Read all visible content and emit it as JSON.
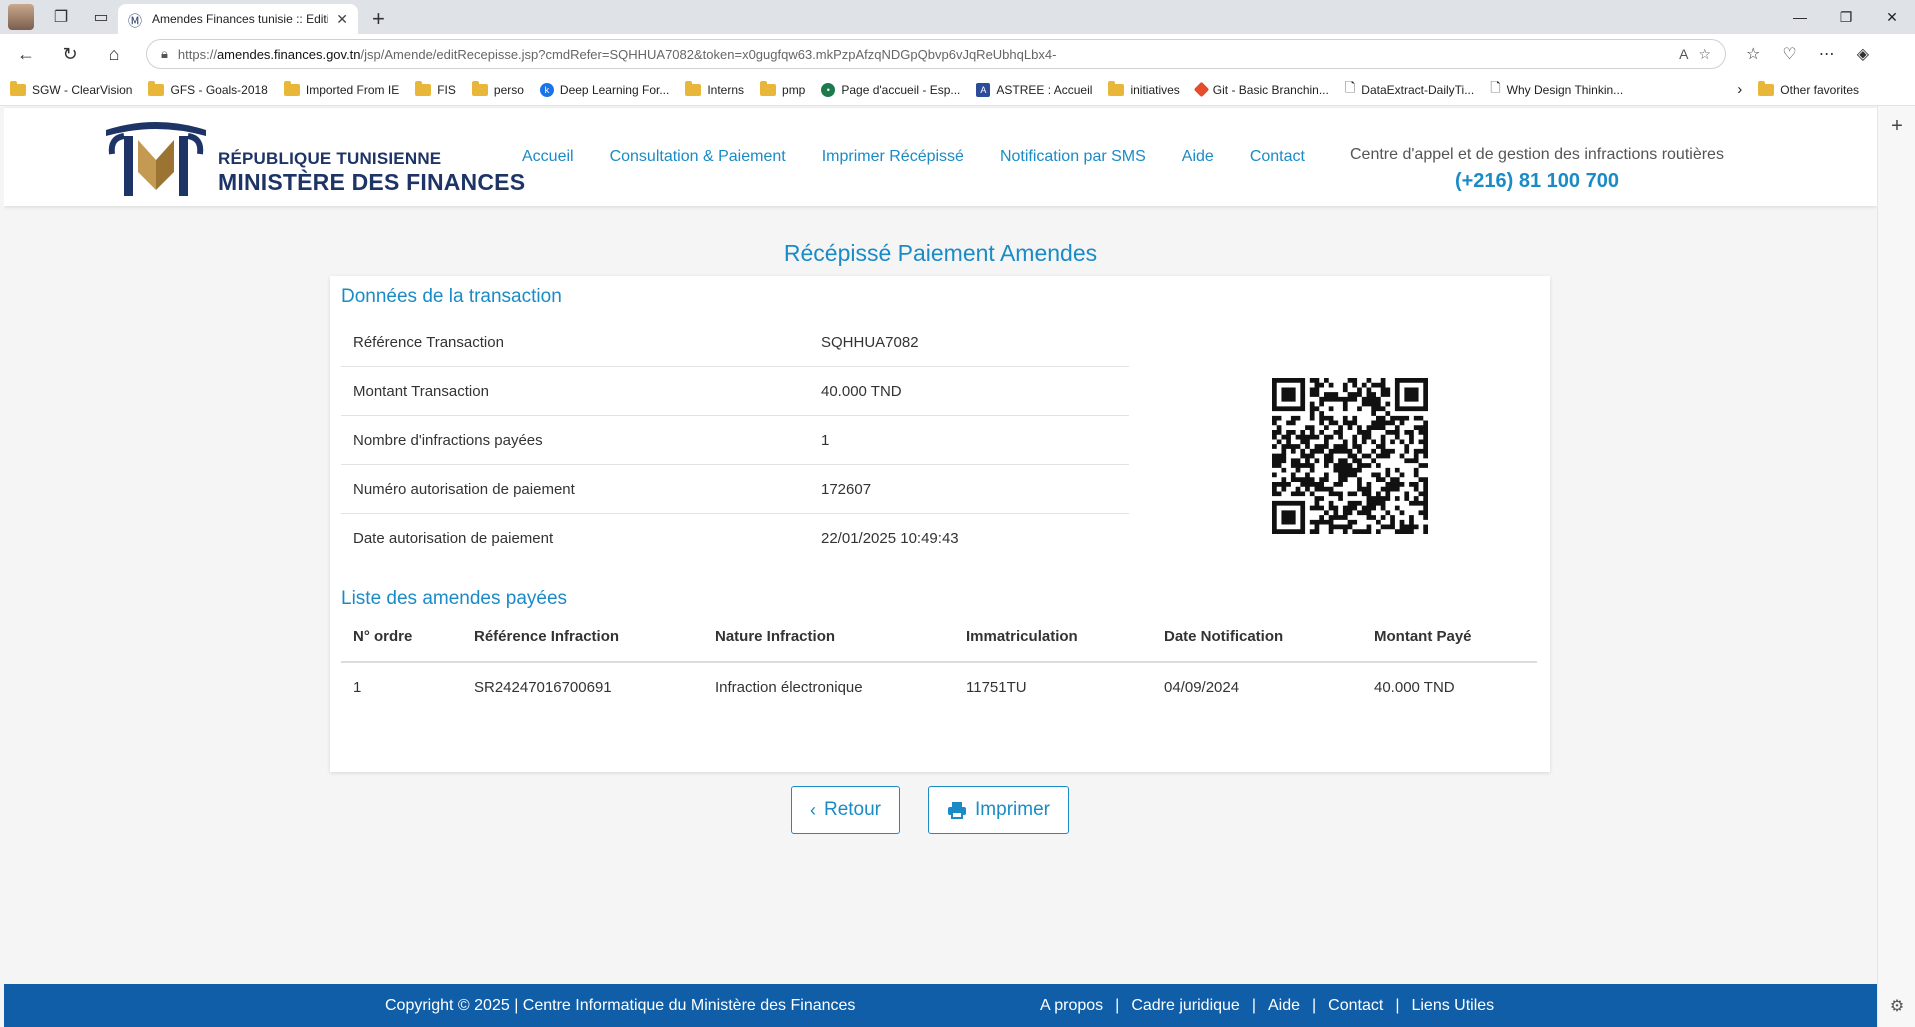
{
  "browser": {
    "tab_title": "Amendes Finances tunisie :: Editio",
    "url_prefix": "https://",
    "url_host": "amendes.finances.gov.tn",
    "url_path": "/jsp/Amende/editRecepisse.jsp?cmdRefer=SQHHUA7082&token=x0gugfqw63.mkPzpAfzqNDGpQbvp6vJqReUbhqLbx4-",
    "bookmarks": [
      "SGW - ClearVision",
      "GFS - Goals-2018",
      "Imported From IE",
      "FIS",
      "perso",
      "Deep Learning For...",
      "Interns",
      "pmp",
      "Page d'accueil - Esp...",
      "ASTREE : Accueil",
      "initiatives",
      "Git - Basic Branchin...",
      "DataExtract-DailyTi...",
      "Why Design Thinkin..."
    ],
    "other_favorites": "Other favorites"
  },
  "header": {
    "logo_line1": "RÉPUBLIQUE TUNISIENNE",
    "logo_line2": "MINISTÈRE DES FINANCES",
    "menu": [
      "Accueil",
      "Consultation & Paiement",
      "Imprimer Récépissé",
      "Notification par SMS",
      "Aide",
      "Contact"
    ],
    "callcenter_label": "Centre d'appel et de gestion des infractions routières",
    "callcenter_phone": "(+216) 81 100 700"
  },
  "page_title": "Récépissé Paiement Amendes",
  "transaction": {
    "section_title": "Données de la transaction",
    "rows": [
      {
        "label": "Référence Transaction",
        "value": "SQHHUA7082"
      },
      {
        "label": "Montant Transaction",
        "value": "40.000 TND"
      },
      {
        "label": "Nombre d'infractions payées",
        "value": "1"
      },
      {
        "label": "Numéro autorisation de paiement",
        "value": "172607"
      },
      {
        "label": "Date autorisation de paiement",
        "value": "22/01/2025 10:49:43"
      }
    ]
  },
  "fines": {
    "section_title": "Liste des amendes payées",
    "headers": [
      "N° ordre",
      "Référence Infraction",
      "Nature Infraction",
      "Immatriculation",
      "Date Notification",
      "Montant Payé"
    ],
    "rows": [
      [
        "1",
        "SR24247016700691",
        "Infraction électronique",
        "11751TU",
        "04/09/2024",
        "40.000 TND"
      ]
    ]
  },
  "buttons": {
    "back": "Retour",
    "print": "Imprimer"
  },
  "footer": {
    "copyright": "Copyright © 2025 | Centre Informatique du Ministère des Finances",
    "links": [
      "A propos",
      "Cadre juridique",
      "Aide",
      "Contact",
      "Liens Utiles"
    ]
  },
  "colors": {
    "accent": "#1a8bc6",
    "brand_dark": "#1f3466",
    "footer_bg": "#0f5ea7"
  }
}
